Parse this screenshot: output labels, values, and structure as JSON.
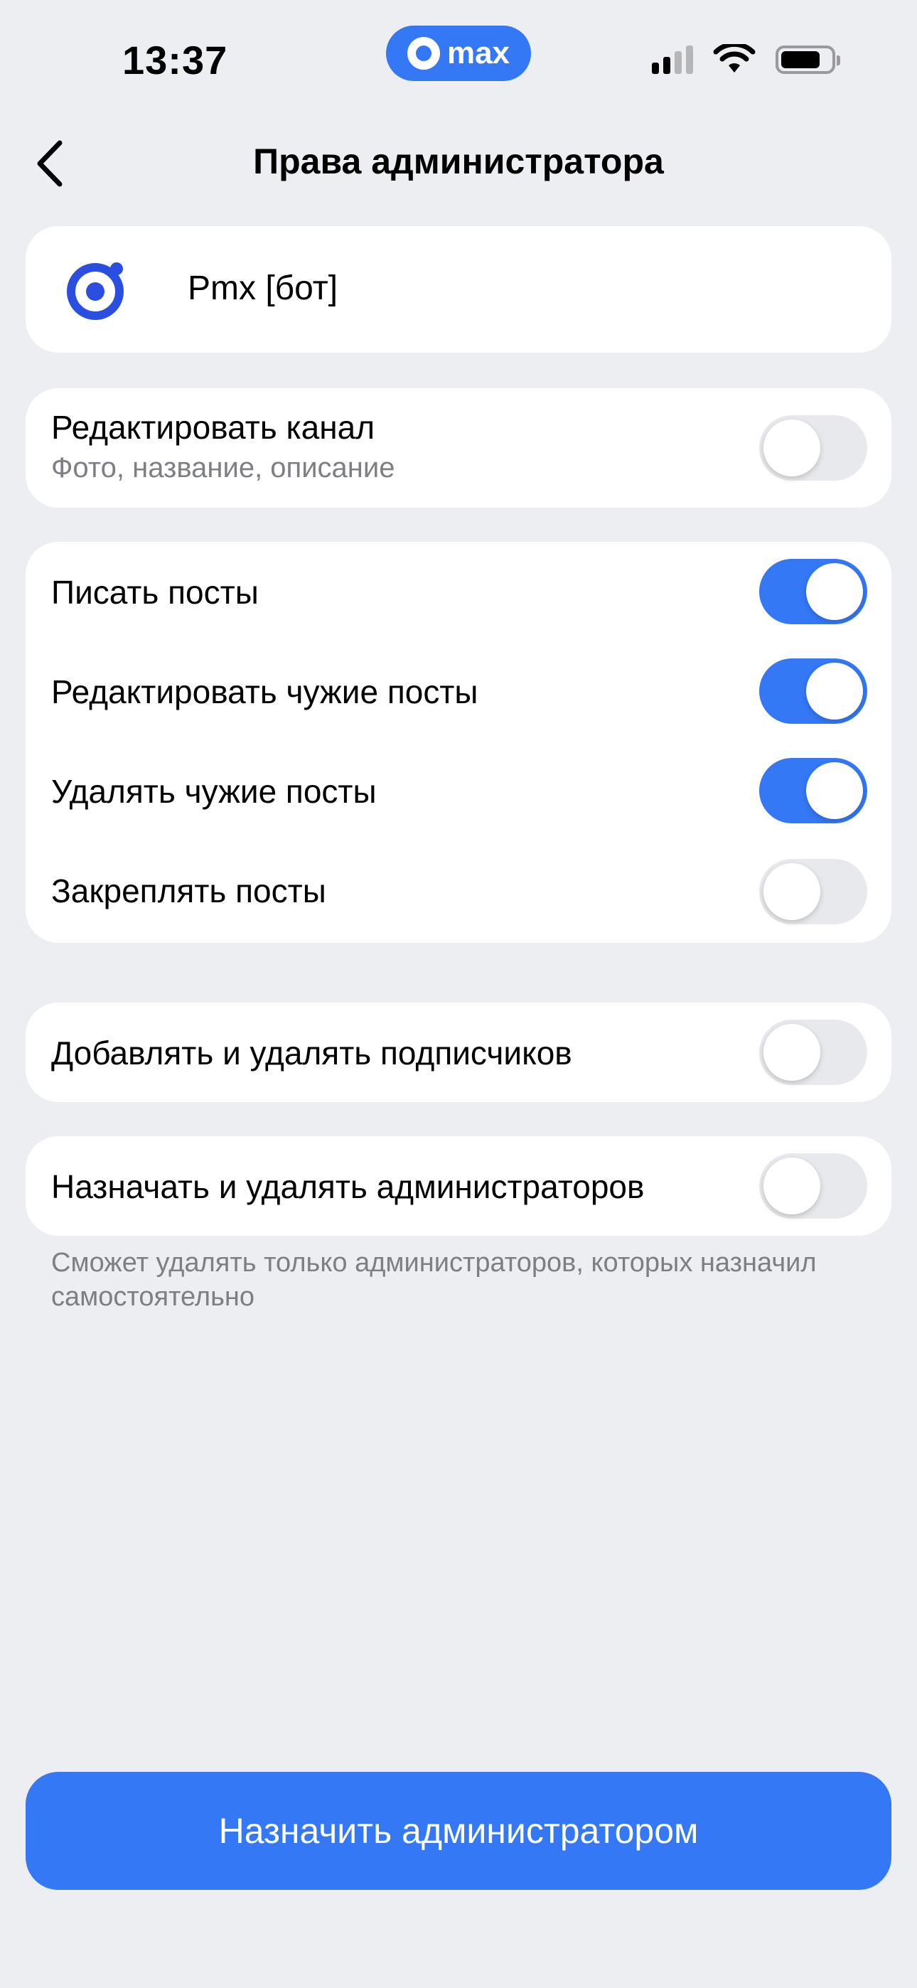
{
  "status_bar": {
    "time": "13:37",
    "app_pill_text": "max"
  },
  "header": {
    "title": "Права администратора"
  },
  "user": {
    "name": "Pmx [бот]"
  },
  "permissions": {
    "edit_channel": {
      "label": "Редактировать канал",
      "sublabel": "Фото, название, описание",
      "enabled": false
    },
    "write_posts": {
      "label": "Писать посты",
      "enabled": true
    },
    "edit_others_posts": {
      "label": "Редактировать чужие посты",
      "enabled": true
    },
    "delete_others_posts": {
      "label": "Удалять чужие посты",
      "enabled": true
    },
    "pin_posts": {
      "label": "Закреплять посты",
      "enabled": false
    },
    "manage_subscribers": {
      "label": "Добавлять и удалять подписчиков",
      "enabled": false
    },
    "manage_admins": {
      "label": "Назначать и удалять администраторов",
      "enabled": false
    }
  },
  "footnote": "Сможет удалять только администраторов, которых назначил самостоятельно",
  "primary_button": {
    "label": "Назначить администратором"
  },
  "colors": {
    "accent": "#3478f6",
    "background": "#edeef2",
    "card": "#ffffff",
    "toggle_off": "#e8e9ec",
    "secondary_text": "#7d7f85"
  }
}
